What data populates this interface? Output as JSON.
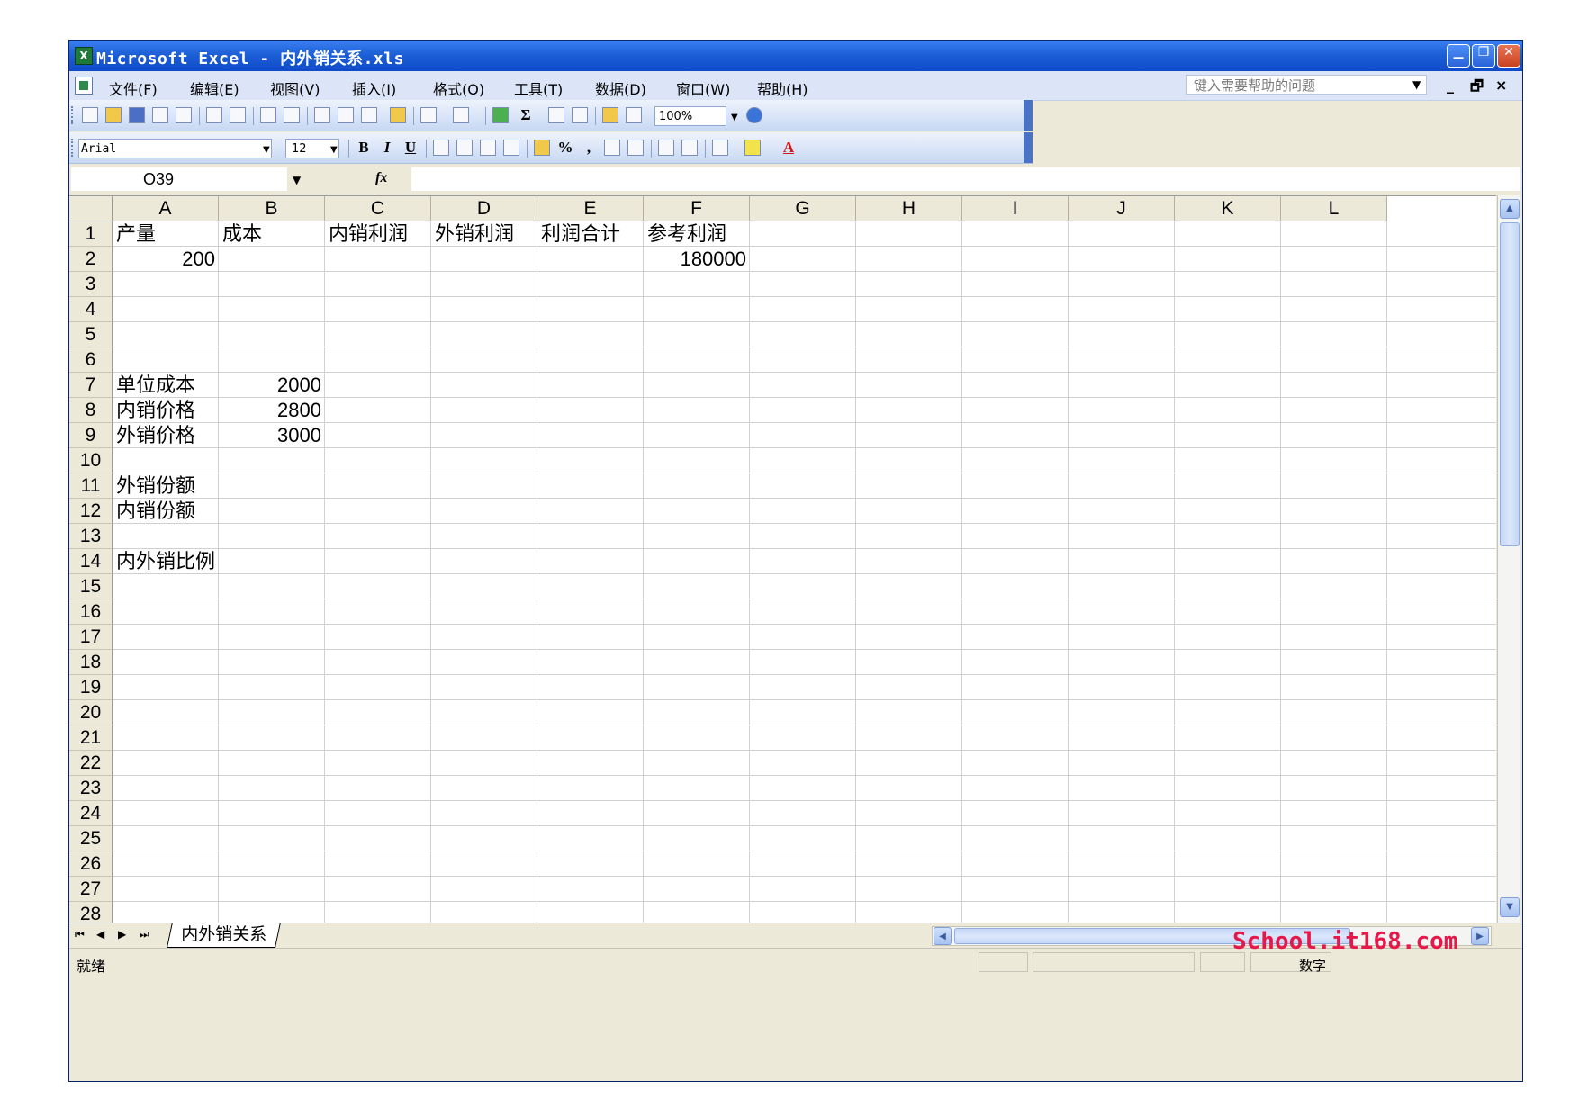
{
  "window": {
    "title": "Microsoft Excel - 内外销关系.xls",
    "minimize": "▁",
    "restore": "❐",
    "close": "✕"
  },
  "menu": [
    {
      "label": "文件(F)"
    },
    {
      "label": "编辑(E)"
    },
    {
      "label": "视图(V)"
    },
    {
      "label": "插入(I)"
    },
    {
      "label": "格式(O)"
    },
    {
      "label": "工具(T)"
    },
    {
      "label": "数据(D)"
    },
    {
      "label": "窗口(W)"
    },
    {
      "label": "帮助(H)"
    }
  ],
  "help_box": {
    "placeholder": "键入需要帮助的问题"
  },
  "doc_controls": {
    "minimize": "_",
    "restore": "🗗",
    "close": "×"
  },
  "standard_toolbar": {
    "zoom": "100%"
  },
  "format_toolbar": {
    "font": "Arial",
    "size": "12",
    "bold": "B",
    "italic": "I",
    "underline": "U",
    "percent": "%",
    "comma": ",",
    "font_color": "A"
  },
  "formula_bar": {
    "name_box": "O39",
    "fx": "fx",
    "formula": ""
  },
  "columns": [
    "A",
    "B",
    "C",
    "D",
    "E",
    "F",
    "G",
    "H",
    "I",
    "J",
    "K",
    "L"
  ],
  "rows": [
    "1",
    "2",
    "3",
    "4",
    "5",
    "6",
    "7",
    "8",
    "9",
    "10",
    "11",
    "12",
    "13",
    "14",
    "15",
    "16",
    "17",
    "18",
    "19",
    "20",
    "21",
    "22",
    "23",
    "24",
    "25",
    "26",
    "27",
    "28"
  ],
  "cells": {
    "A1": "产量",
    "B1": "成本",
    "C1": "内销利润",
    "D1": "外销利润",
    "E1": "利润合计",
    "F1": "参考利润",
    "A2": "200",
    "F2": "180000",
    "A7": "单位成本",
    "B7": "2000",
    "A8": "内销价格",
    "B8": "2800",
    "A9": "外销价格",
    "B9": "3000",
    "A11": "外销份额",
    "A12": "内销份额",
    "A14": "内外销比例"
  },
  "sheet_tabs": [
    {
      "label": "内外销关系",
      "active": true
    }
  ],
  "status": {
    "left": "就绪",
    "num": "数字"
  },
  "watermark": "School.it168.com"
}
